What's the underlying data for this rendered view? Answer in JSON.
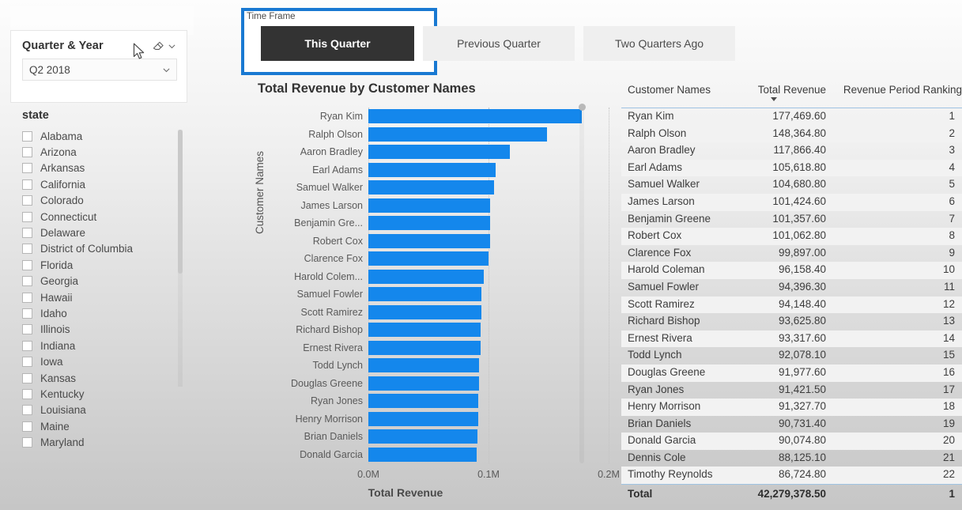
{
  "quarter_slicer": {
    "title": "Quarter & Year",
    "selected_value": "Q2 2018",
    "clear_icon": "eraser-icon",
    "expand_icon": "chevron-down-icon",
    "dropdown_icon": "chevron-down-icon"
  },
  "state_slicer": {
    "title": "state",
    "items": [
      "Alabama",
      "Arizona",
      "Arkansas",
      "California",
      "Colorado",
      "Connecticut",
      "Delaware",
      "District of Columbia",
      "Florida",
      "Georgia",
      "Hawaii",
      "Idaho",
      "Illinois",
      "Indiana",
      "Iowa",
      "Kansas",
      "Kentucky",
      "Louisiana",
      "Maine",
      "Maryland"
    ]
  },
  "time_frame": {
    "label": "Time Frame",
    "options": [
      "This Quarter",
      "Previous Quarter",
      "Two Quarters Ago"
    ],
    "selected": "This Quarter",
    "selected_bg": "#333333",
    "unselected_bg": "#efefef",
    "focus_border_color": "#1979d2"
  },
  "table": {
    "columns": [
      "Customer Names",
      "Total Revenue",
      "Revenue Period Ranking"
    ],
    "sort_column": "Total Revenue",
    "sort_direction": "descending",
    "rows": [
      {
        "name": "Ryan Kim",
        "revenue": "177,469.60",
        "rank": "1"
      },
      {
        "name": "Ralph Olson",
        "revenue": "148,364.80",
        "rank": "2"
      },
      {
        "name": "Aaron Bradley",
        "revenue": "117,866.40",
        "rank": "3"
      },
      {
        "name": "Earl Adams",
        "revenue": "105,618.80",
        "rank": "4"
      },
      {
        "name": "Samuel Walker",
        "revenue": "104,680.80",
        "rank": "5"
      },
      {
        "name": "James Larson",
        "revenue": "101,424.60",
        "rank": "6"
      },
      {
        "name": "Benjamin Greene",
        "revenue": "101,357.60",
        "rank": "7"
      },
      {
        "name": "Robert Cox",
        "revenue": "101,062.80",
        "rank": "8"
      },
      {
        "name": "Clarence Fox",
        "revenue": "99,897.00",
        "rank": "9"
      },
      {
        "name": "Harold Coleman",
        "revenue": "96,158.40",
        "rank": "10"
      },
      {
        "name": "Samuel Fowler",
        "revenue": "94,396.30",
        "rank": "11"
      },
      {
        "name": "Scott Ramirez",
        "revenue": "94,148.40",
        "rank": "12"
      },
      {
        "name": "Richard Bishop",
        "revenue": "93,625.80",
        "rank": "13"
      },
      {
        "name": "Ernest Rivera",
        "revenue": "93,317.60",
        "rank": "14"
      },
      {
        "name": "Todd Lynch",
        "revenue": "92,078.10",
        "rank": "15"
      },
      {
        "name": "Douglas Greene",
        "revenue": "91,977.60",
        "rank": "16"
      },
      {
        "name": "Ryan Jones",
        "revenue": "91,421.50",
        "rank": "17"
      },
      {
        "name": "Henry Morrison",
        "revenue": "91,327.70",
        "rank": "18"
      },
      {
        "name": "Brian Daniels",
        "revenue": "90,731.40",
        "rank": "19"
      },
      {
        "name": "Donald Garcia",
        "revenue": "90,074.80",
        "rank": "20"
      },
      {
        "name": "Dennis Cole",
        "revenue": "88,125.10",
        "rank": "21"
      },
      {
        "name": "Timothy Reynolds",
        "revenue": "86,724.80",
        "rank": "22"
      }
    ],
    "total": {
      "name": "Total",
      "revenue": "42,279,378.50",
      "rank": "1"
    }
  },
  "chart_data": {
    "type": "bar",
    "orientation": "horizontal",
    "title": "Total Revenue by Customer Names",
    "xlabel": "Total Revenue",
    "ylabel": "Customer Names",
    "xlim": [
      0,
      200000
    ],
    "xticks": [
      0,
      100000,
      200000
    ],
    "xtick_labels": [
      "0.0M",
      "0.1M",
      "0.2M"
    ],
    "grid": "vertical-dotted",
    "bar_color": "#1487ec",
    "legend": "none",
    "categories": [
      "Ryan Kim",
      "Ralph Olson",
      "Aaron Bradley",
      "Earl Adams",
      "Samuel Walker",
      "James Larson",
      "Benjamin Gre...",
      "Robert Cox",
      "Clarence Fox",
      "Harold Colem...",
      "Samuel Fowler",
      "Scott Ramirez",
      "Richard Bishop",
      "Ernest Rivera",
      "Todd Lynch",
      "Douglas Greene",
      "Ryan Jones",
      "Henry Morrison",
      "Brian Daniels",
      "Donald Garcia"
    ],
    "values": [
      177469.6,
      148364.8,
      117866.4,
      105618.8,
      104680.8,
      101424.6,
      101357.6,
      101062.8,
      99897.0,
      96158.4,
      94396.3,
      94148.4,
      93625.8,
      93317.6,
      92078.1,
      91977.6,
      91421.5,
      91327.7,
      90731.4,
      90074.8
    ]
  }
}
